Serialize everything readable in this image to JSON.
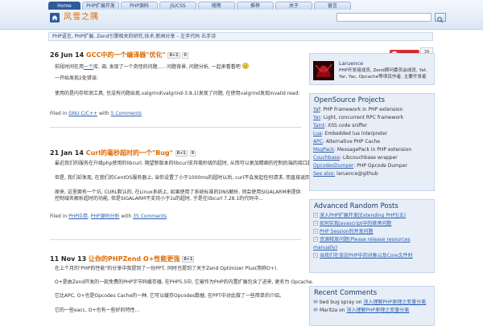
{
  "nav": {
    "tabs": [
      {
        "label": "Home",
        "width": 40
      },
      {
        "label": "PHP扩展开发",
        "width": 46
      },
      {
        "label": "PHP源码",
        "width": 46
      },
      {
        "label": "JS/CSS",
        "width": 46
      },
      {
        "label": "随笔",
        "width": 46
      },
      {
        "label": "推荐",
        "width": 46
      },
      {
        "label": "关于",
        "width": 46
      },
      {
        "label": "留言",
        "width": 46
      }
    ],
    "site_title": "风雪之隅",
    "search_placeholder": ""
  },
  "description": "PHP语言, PHP扩展, Zend引擎相关的研究,技术,新闻分享 – 左手代码 右手诗",
  "posts": [
    {
      "date": "26 Jun 14",
      "title": "GCC中的一个编译器\"优化\"",
      "gplus": "8+1",
      "count": "0",
      "para1_pre": "前段时间在用",
      "para1_link": "一个",
      "para1_post": "库, 调, 发现了一个奇怪的问题..... 问题背景, 问题分析, 一起来看看吧",
      "para2": "一开始发现2处错误:",
      "para3": "使用的是内存检测工具, 也没有问题出现,valgrind(valgrind-3.8.1)发现了问题, 在使用valgrind发现invalid read:",
      "filed_label": "Filed in",
      "category": "GNU C/C++",
      "with_label": "with",
      "comments": "5 Comments"
    },
    {
      "date": "21 Jan 14",
      "title": "Curl的毫秒超时的一个\"Bug\"",
      "gplus": "8+1",
      "count": "9",
      "para1": "最近我们的服务在升级php使用的libcurl, 期望新版本的libcurl支持毫秒级的超时, 从而可以更加精细的控制后端的接口超时, 从而提高整体响应时间。",
      "para2": "但是, 我们却发现, 在我们的CentOS服务器上, 当你设置了小于1000ms的超时以后, curl不会发起任何请求, 而直接返回超时错误(Timeout reached 28).",
      "para3": "原来, 这里面有一个坑, CURL默认的, 在Linux系统上, 如果使用了系统标准的DNS解析, 则会使用SIGALARM来提供控制域名解析超时的功能, 但是SIGALARM不支持小于1s的超时, 于是在libcurl 7.28.1的代码中...",
      "filed_label": "Filed in",
      "category1": "PHP应用",
      "category2": "PHP源码分析",
      "with_label": "with",
      "comments": "35 Comments"
    },
    {
      "date": "11 Nov 13",
      "title_pre": "让你的PHP",
      "title_mid": "Zend O+",
      "title_post": "性能更强",
      "gplus": "8+1",
      "para1": "在上个月的\"PHP的性能\"的分享中我提到了一份PPT, 同时也提到了关于Zend Optimizer Plus(简称O+).",
      "para2": "O+是由Zend开发的一款免费的PHP字节码缓存器, 在PHP5.5中, 它被作为PHP的内置扩展包含了进来, 更名为 Opcache.",
      "para3": "它比APC, O+也是Opcodes Cache的一种, 它可以缓存Opcodes数据, 在PPT中对此做了一些简单的介绍。",
      "para4": "它的一些eacc, O+也有一些好的特性..."
    }
  ],
  "sidebar": {
    "rss_count": "39",
    "profile": {
      "name": "Laruence",
      "desc": "PHP开发组成员, Zend顾问委员会成员, Yaf, Yar, Yac, Opcache等项目作者, 主要开发者"
    },
    "opensource": {
      "title": "OpenSource Projects",
      "items": [
        {
          "name": "Yaf",
          "desc": ": PHP Framework in PHP extension"
        },
        {
          "name": "Yar",
          "desc": ": Light, concurrent RPC framework"
        },
        {
          "name": "Taint",
          "desc": ": XSS code sniffer"
        },
        {
          "name": "Lua",
          "desc": ": Embedded lua interpreter"
        },
        {
          "name": "APC",
          "desc": ": Alternative PHP Cache"
        },
        {
          "name": "MsgPack",
          "desc": ": MessagePack in PHP extension"
        },
        {
          "name": "Couchbase",
          "desc": ": Libcouchbase wrapper"
        },
        {
          "name": "OpcodesDumper",
          "desc": ": PHP Opcode Dumper"
        },
        {
          "name": "See also:",
          "desc": " laruence@github"
        }
      ]
    },
    "random": {
      "title": "Advanced Random Posts",
      "items": [
        "深入PHP扩展开发[Extending PHP](五)",
        "如何实现javascript中的继承问题",
        "PHP Session的并发问题",
        "资源释放问题(Please release resources manually)",
        "当我们在谈论PHP中的对象以及Core文件时"
      ]
    },
    "comments": {
      "title": "Recent Comments",
      "items": [
        {
          "author": "bed bug spray",
          "on": "on",
          "post": "深入理解PHP原理之变量分离"
        },
        {
          "author": "Maritza",
          "on": "on",
          "post": "深入理解PHP原理之变量分离"
        }
      ]
    }
  },
  "colors": {
    "accent": "#e06a00",
    "link": "#2a5db0",
    "nav_active": "#2f5a9c",
    "widget_bg": "#e7eef8"
  },
  "icons": [
    "home-icon",
    "search-icon",
    "smiley-icon",
    "rss-icon",
    "avatar",
    "comment-icon"
  ]
}
